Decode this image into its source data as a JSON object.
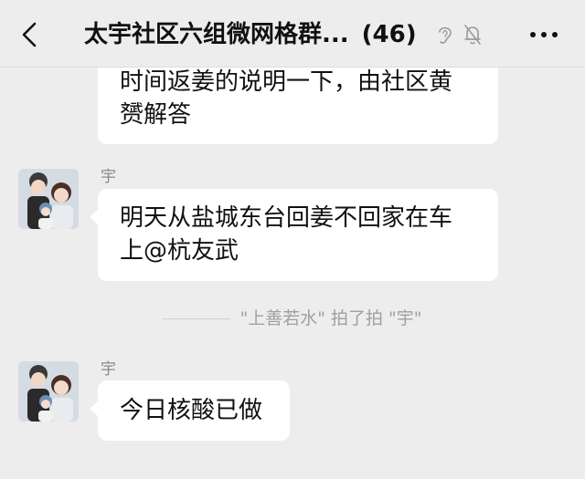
{
  "header": {
    "title": "太宇社区六组微网格群...",
    "member_count": "(46)",
    "icons": [
      "back-icon",
      "ear-icon",
      "mute-icon",
      "more-icon"
    ]
  },
  "messages": [
    {
      "text_line1": "时间返姜的说明一下，由社区黄",
      "text_line2": "赟解答"
    },
    {
      "sender": "宇",
      "text_line1": "明天从盐城东台回姜不回家在车",
      "text_line2": "上@杭友武"
    },
    {
      "sender": "宇",
      "text_line1": "今日核酸已做"
    }
  ],
  "system_notice": "\"上善若水\" 拍了拍 \"宇\"",
  "colors": {
    "background": "#ededed",
    "bubble": "#ffffff",
    "system_text": "#a0a0a0"
  }
}
